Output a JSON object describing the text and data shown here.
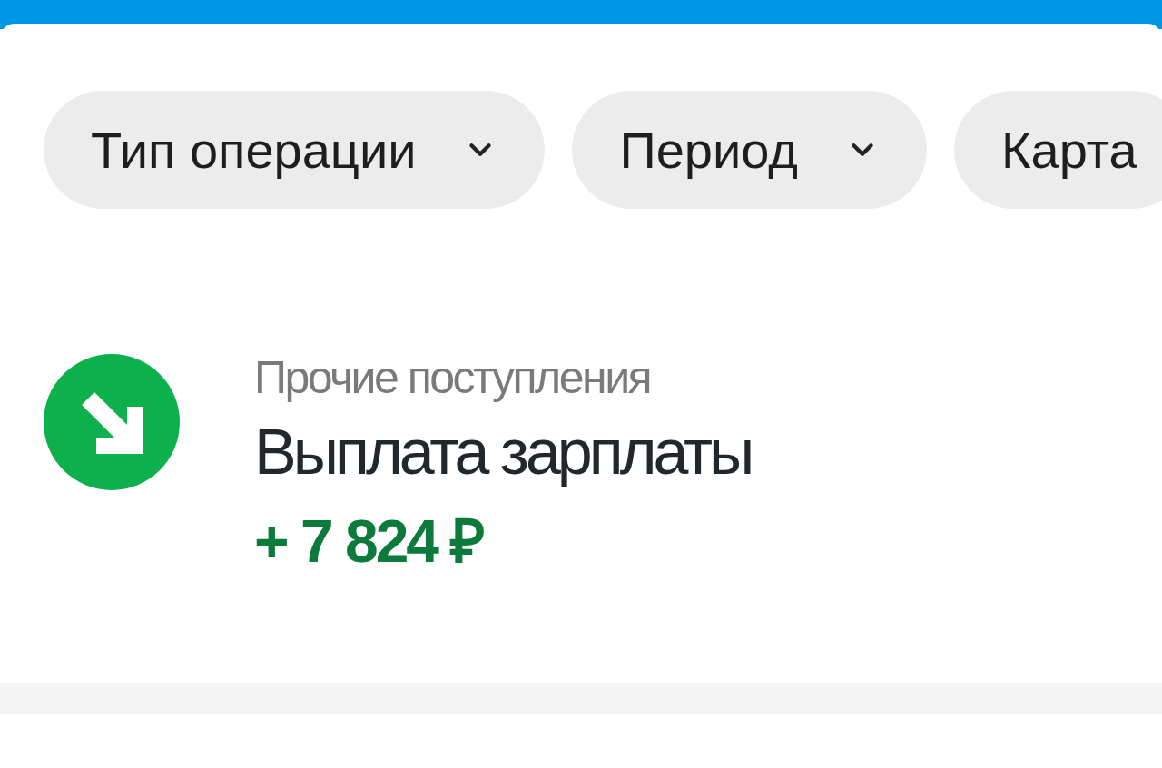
{
  "filters": [
    {
      "label": "Тип операции",
      "dropdown": true
    },
    {
      "label": "Период",
      "dropdown": true
    },
    {
      "label": "Карта",
      "dropdown": false
    }
  ],
  "operation": {
    "category": "Прочие поступления",
    "title": "Выплата зарплаты",
    "amount": "+ 7 824 ₽"
  }
}
